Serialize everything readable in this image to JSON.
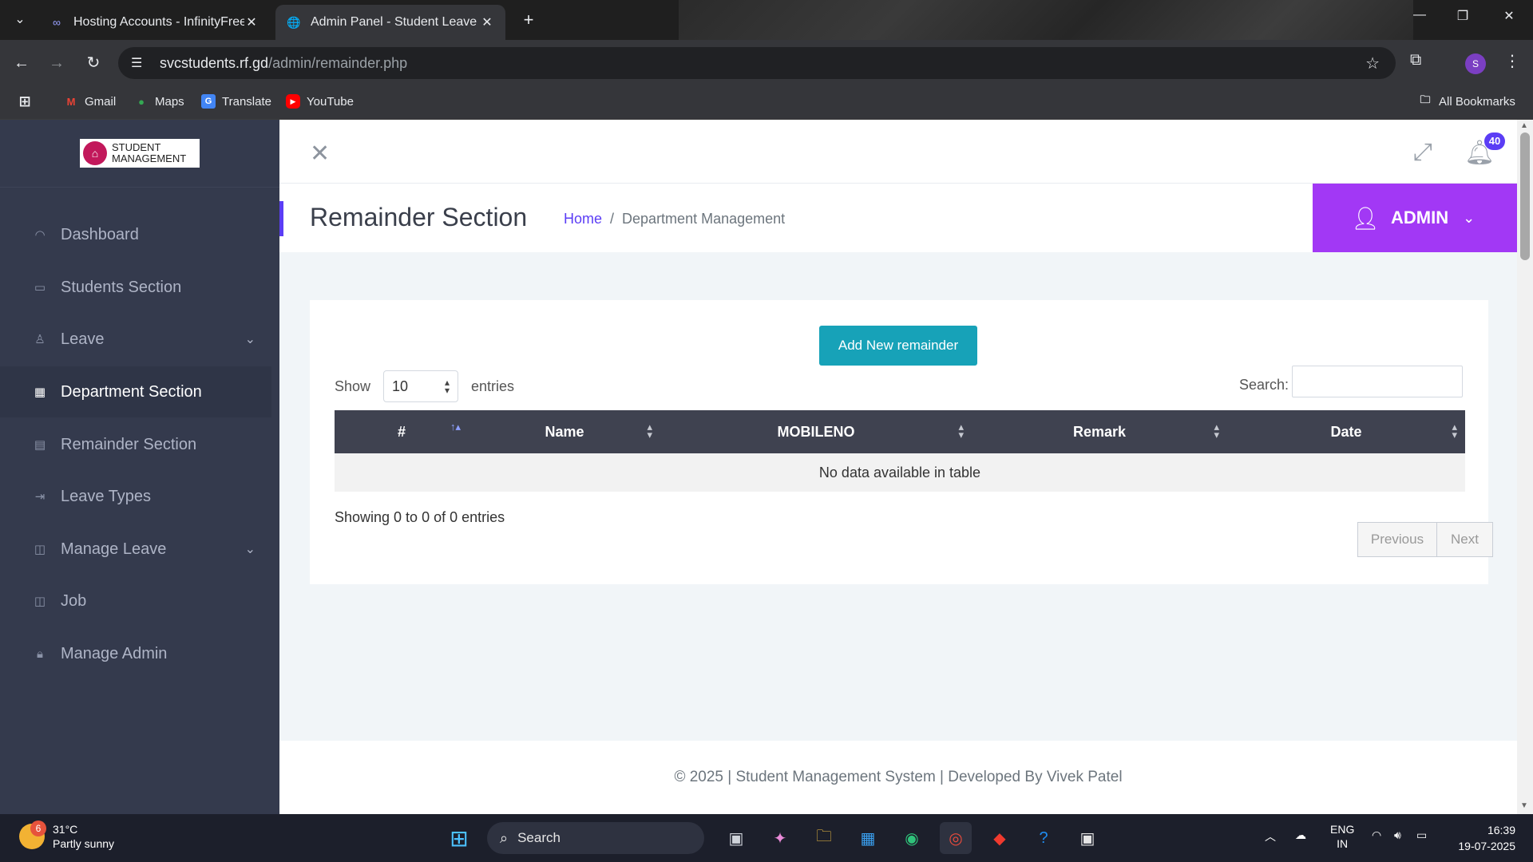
{
  "browser": {
    "tabs": [
      {
        "title": "Hosting Accounts - InfinityFree",
        "icon": "infinity-icon",
        "active": false
      },
      {
        "title": "Admin Panel - Student Leave",
        "icon": "globe-icon",
        "active": true
      }
    ],
    "url_domain": "svcstudents.rf.gd",
    "url_path": "/admin/remainder.php",
    "profile_initial": "S",
    "bookmarks": [
      {
        "label": "Gmail",
        "icon": "gmail-icon"
      },
      {
        "label": "Maps",
        "icon": "maps-icon"
      },
      {
        "label": "Translate",
        "icon": "translate-icon"
      },
      {
        "label": "YouTube",
        "icon": "youtube-icon"
      }
    ],
    "all_bookmarks": "All Bookmarks"
  },
  "sidebar": {
    "logo_line1": "STUDENT",
    "logo_line2": "MANAGEMENT",
    "items": [
      {
        "label": "Dashboard",
        "icon": "dashboard-icon",
        "chevron": false,
        "active": false
      },
      {
        "label": "Students Section",
        "icon": "id-card-icon",
        "chevron": false,
        "active": false
      },
      {
        "label": "Leave",
        "icon": "user-icon",
        "chevron": true,
        "active": false
      },
      {
        "label": "Department Section",
        "icon": "grid-icon",
        "chevron": false,
        "active": true
      },
      {
        "label": "Remainder Section",
        "icon": "calendar-icon",
        "chevron": false,
        "active": false
      },
      {
        "label": "Leave Types",
        "icon": "sign-out-icon",
        "chevron": false,
        "active": false
      },
      {
        "label": "Manage Leave",
        "icon": "briefcase-icon",
        "chevron": true,
        "active": false
      },
      {
        "label": "Job",
        "icon": "briefcase-icon",
        "chevron": false,
        "active": false
      },
      {
        "label": "Manage Admin",
        "icon": "lock-icon",
        "chevron": false,
        "active": false
      }
    ]
  },
  "header": {
    "notification_count": "40",
    "page_title": "Remainder Section",
    "breadcrumb_home": "Home",
    "breadcrumb_sep": "/",
    "breadcrumb_current": "Department Management",
    "admin_name": "ADMIN",
    "accent_color": "#a238f5"
  },
  "content": {
    "add_button": "Add New remainder",
    "show_label": "Show",
    "show_value": "10",
    "entries_label": "entries",
    "search_label": "Search:",
    "table": {
      "columns": [
        "#",
        "Name",
        "MOBILENO",
        "Remark",
        "Date"
      ],
      "empty_message": "No data available in table"
    },
    "info": "Showing 0 to 0 of 0 entries",
    "prev": "Previous",
    "next": "Next"
  },
  "footer": {
    "text": "© 2025 | Student Management System | Developed By Vivek Patel"
  },
  "taskbar": {
    "weather_temp": "31°C",
    "weather_desc": "Partly sunny",
    "weather_badge": "6",
    "search_label": "Search",
    "lang_line1": "ENG",
    "lang_line2": "IN",
    "time": "16:39",
    "date": "19-07-2025"
  }
}
